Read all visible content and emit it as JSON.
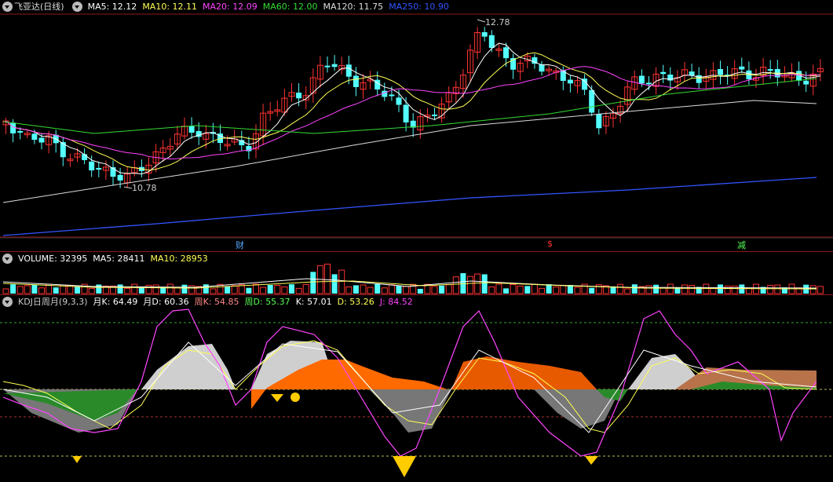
{
  "main": {
    "title": "飞亚达(日线)",
    "ma": [
      {
        "label": "MA5: 12.12",
        "color": "#ffffff"
      },
      {
        "label": "MA10: 12.11",
        "color": "#ffff55"
      },
      {
        "label": "MA20: 12.09",
        "color": "#ff44ff"
      },
      {
        "label": "MA60: 12.00",
        "color": "#33dd33"
      },
      {
        "label": "MA120: 11.75",
        "color": "#dddddd"
      },
      {
        "label": "MA250: 10.90",
        "color": "#3355ff"
      }
    ],
    "high_label": "12.78",
    "low_label": "10.78",
    "markers": [
      {
        "text": "财",
        "color": "#55aaff"
      },
      {
        "text": "$",
        "color": "#ff3333"
      },
      {
        "text": "减",
        "color": "#55ff55"
      }
    ]
  },
  "volume": {
    "items": [
      {
        "label": "VOLUME: 32395",
        "color": "#ffffff"
      },
      {
        "label": "MA5: 28411",
        "color": "#ffffff"
      },
      {
        "label": "MA10: 28953",
        "color": "#ffff55"
      }
    ]
  },
  "kdj": {
    "items": [
      {
        "label": "KDJ日周月(9,3,3)",
        "color": "#cccccc"
      },
      {
        "label": "月K: 64.49",
        "color": "#ffffff"
      },
      {
        "label": "月D: 60.36",
        "color": "#ffffff"
      },
      {
        "label": "周K: 54.85",
        "color": "#ff8888"
      },
      {
        "label": "周D: 55.37",
        "color": "#55ff55"
      },
      {
        "label": "K: 57.01",
        "color": "#ffffff"
      },
      {
        "label": "D: 53.26",
        "color": "#ffff55"
      },
      {
        "label": "J: 84.52",
        "color": "#ff44ff"
      }
    ]
  },
  "colors": {
    "up": "#ff3333",
    "down": "#54ffff",
    "separator": "#8b1a1a"
  }
}
